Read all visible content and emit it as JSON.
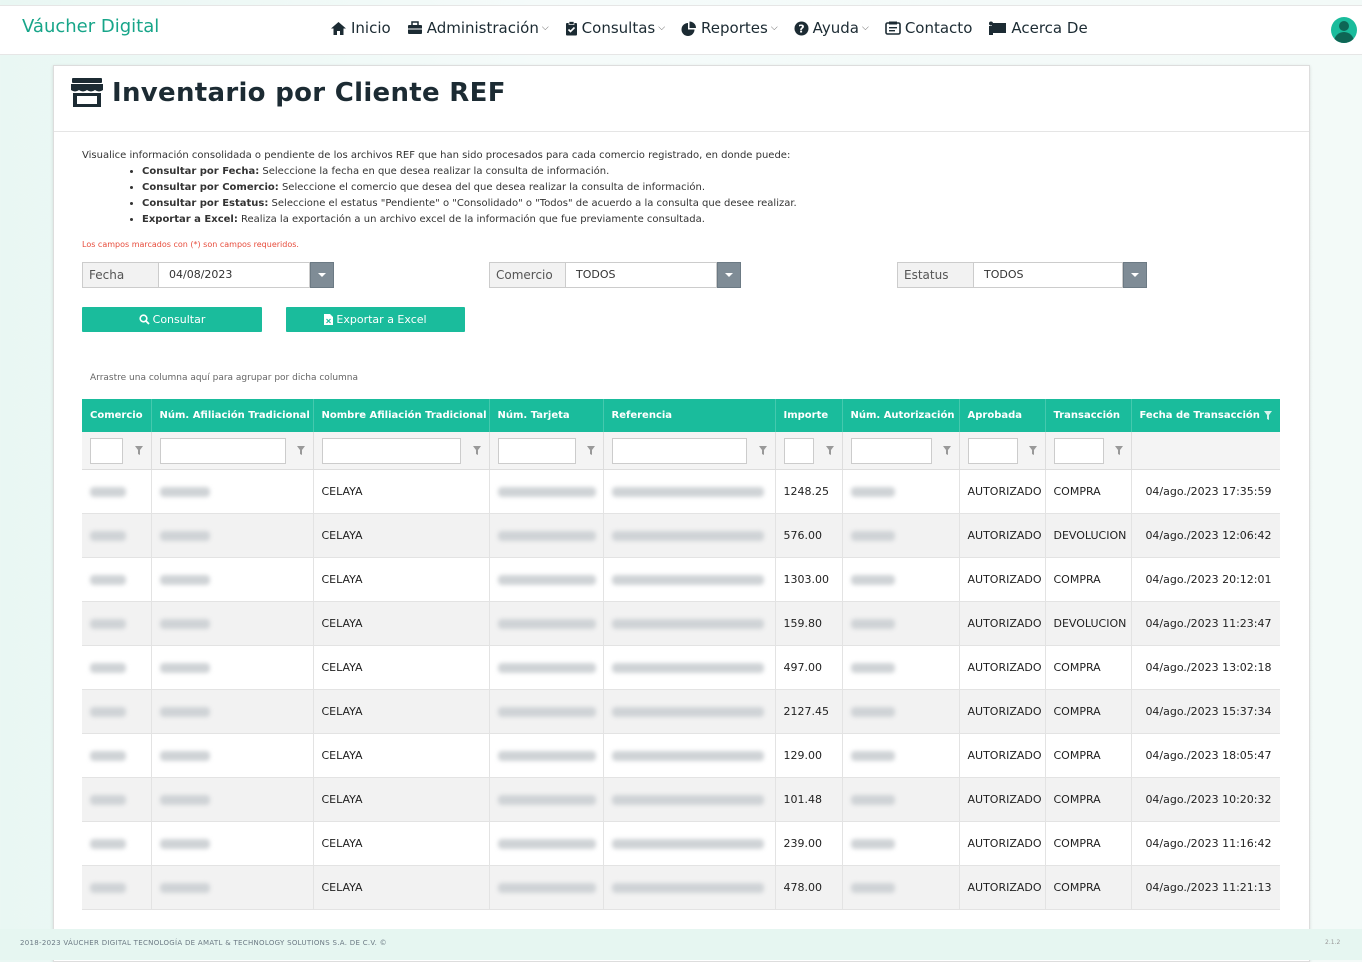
{
  "brand": "Váucher Digital",
  "nav": [
    {
      "label": "Inicio",
      "icon": "home-icon",
      "caret": false
    },
    {
      "label": "Administración",
      "icon": "briefcase-icon",
      "caret": true
    },
    {
      "label": "Consultas",
      "icon": "clipboard-check-icon",
      "caret": true
    },
    {
      "label": "Reportes",
      "icon": "pie-chart-icon",
      "caret": true
    },
    {
      "label": "Ayuda",
      "icon": "question-circle-icon",
      "caret": true
    },
    {
      "label": "Contacto",
      "icon": "contact-card-icon",
      "caret": false
    },
    {
      "label": "Acerca De",
      "icon": "presentation-icon",
      "caret": false
    }
  ],
  "page": {
    "title": "Inventario por Cliente REF",
    "intro": "Visualice información consolidada o pendiente de los archivos REF que han sido procesados para cada comercio registrado, en donde puede:",
    "bullets": [
      {
        "bold": "Consultar por Fecha:",
        "text": " Seleccione la fecha en que desea realizar la consulta de información."
      },
      {
        "bold": "Consultar por Comercio:",
        "text": " Seleccione el comercio que desea del que desea realizar la consulta de información."
      },
      {
        "bold": "Consultar por Estatus:",
        "text": " Seleccione el estatus \"Pendiente\" o \"Consolidado\" o \"Todos\" de acuerdo a la consulta que desee realizar."
      },
      {
        "bold": "Exportar a Excel:",
        "text": " Realiza la exportación a un archivo excel de la información que fue previamente consultada."
      }
    ],
    "required_note": "Los campos marcados con (*) son campos requeridos."
  },
  "filters": {
    "fecha": {
      "label": "Fecha",
      "value": "04/08/2023"
    },
    "comercio": {
      "label": "Comercio",
      "value": "TODOS"
    },
    "estatus": {
      "label": "Estatus",
      "value": "TODOS"
    }
  },
  "buttons": {
    "consultar": "Consultar",
    "exportar": "Exportar a Excel"
  },
  "grid": {
    "group_hint": "Arrastre una columna aquí para agrupar por dicha columna",
    "columns": [
      "Comercio",
      "Núm. Afiliación Tradicional",
      "Nombre Afiliación Tradicional",
      "Núm. Tarjeta",
      "Referencia",
      "Importe",
      "Núm. Autorización",
      "Aprobada",
      "Transacción",
      "Fecha de Transacción"
    ],
    "rows": [
      {
        "nombre": "CELAYA",
        "importe": "1248.25",
        "aprobada": "AUTORIZADO",
        "transaccion": "COMPRA",
        "fecha": "04/ago./2023 17:35:59"
      },
      {
        "nombre": "CELAYA",
        "importe": "576.00",
        "aprobada": "AUTORIZADO",
        "transaccion": "DEVOLUCION",
        "fecha": "04/ago./2023 12:06:42"
      },
      {
        "nombre": "CELAYA",
        "importe": "1303.00",
        "aprobada": "AUTORIZADO",
        "transaccion": "COMPRA",
        "fecha": "04/ago./2023 20:12:01"
      },
      {
        "nombre": "CELAYA",
        "importe": "159.80",
        "aprobada": "AUTORIZADO",
        "transaccion": "DEVOLUCION",
        "fecha": "04/ago./2023 11:23:47"
      },
      {
        "nombre": "CELAYA",
        "importe": "497.00",
        "aprobada": "AUTORIZADO",
        "transaccion": "COMPRA",
        "fecha": "04/ago./2023 13:02:18"
      },
      {
        "nombre": "CELAYA",
        "importe": "2127.45",
        "aprobada": "AUTORIZADO",
        "transaccion": "COMPRA",
        "fecha": "04/ago./2023 15:37:34"
      },
      {
        "nombre": "CELAYA",
        "importe": "129.00",
        "aprobada": "AUTORIZADO",
        "transaccion": "COMPRA",
        "fecha": "04/ago./2023 18:05:47"
      },
      {
        "nombre": "CELAYA",
        "importe": "101.48",
        "aprobada": "AUTORIZADO",
        "transaccion": "COMPRA",
        "fecha": "04/ago./2023 10:20:32"
      },
      {
        "nombre": "CELAYA",
        "importe": "239.00",
        "aprobada": "AUTORIZADO",
        "transaccion": "COMPRA",
        "fecha": "04/ago./2023 11:16:42"
      },
      {
        "nombre": "CELAYA",
        "importe": "478.00",
        "aprobada": "AUTORIZADO",
        "transaccion": "COMPRA",
        "fecha": "04/ago./2023 11:21:13"
      }
    ]
  },
  "footer": {
    "copyright": "2018-2023 VÁUCHER DIGITAL TECNOLOGÍA DE AMATL & TECHNOLOGY SOLUTIONS S.A. DE C.V. ©",
    "version": "2.1.2"
  },
  "colors": {
    "accent": "#1abc9c",
    "brand": "#17a589",
    "dropdown": "#7f8c96",
    "required": "#e74c3c"
  }
}
